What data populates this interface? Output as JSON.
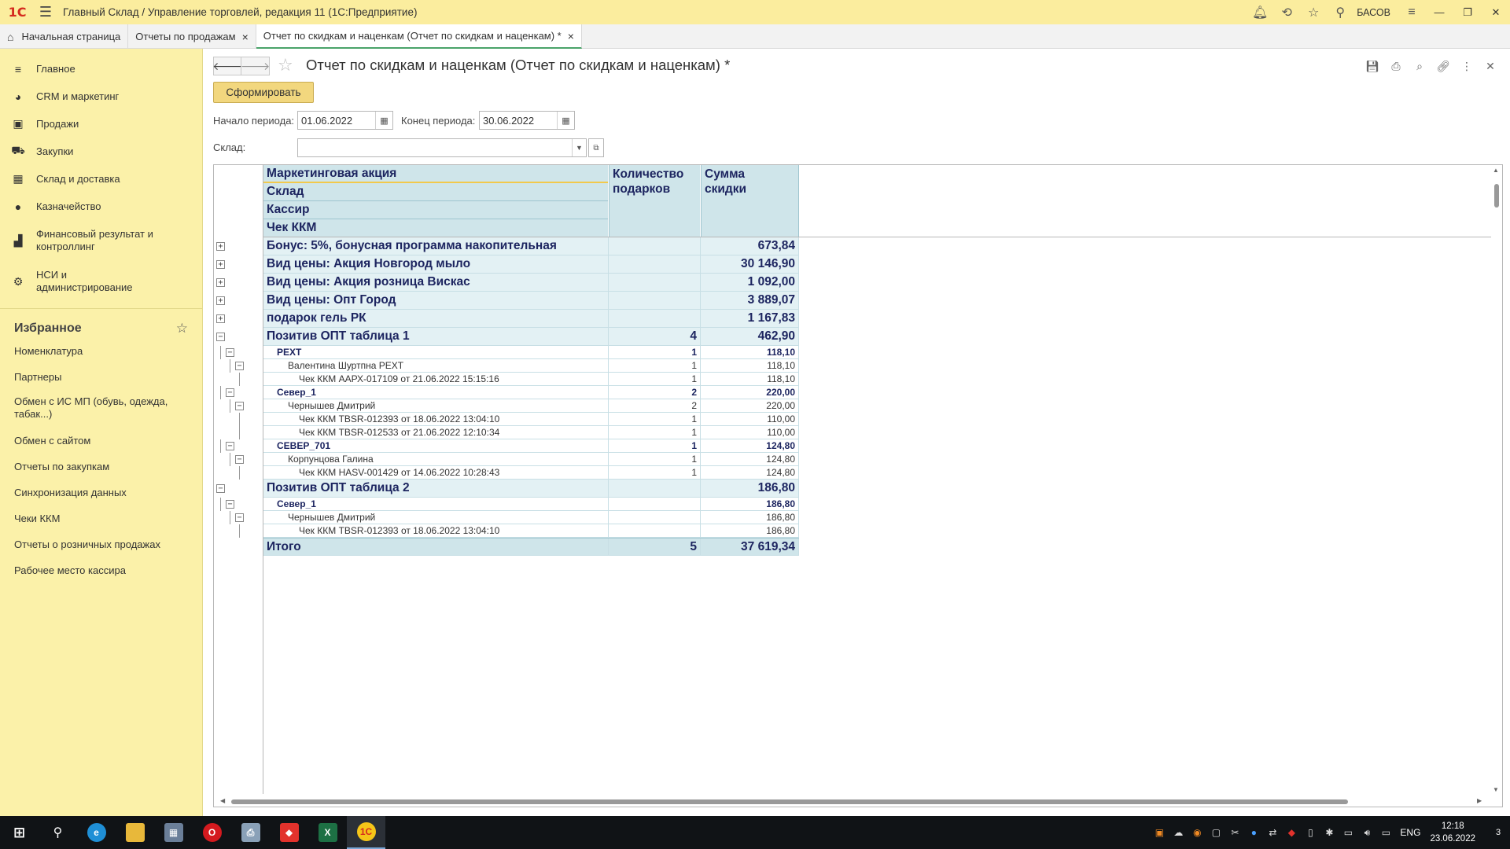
{
  "titlebar": {
    "logo": "1С",
    "title": "Главный Склад / Управление торговлей, редакция 11  (1С:Предприятие)",
    "user": "БАСОВ"
  },
  "tabs": [
    {
      "label": "Начальная страница"
    },
    {
      "label": "Отчеты по продажам"
    },
    {
      "label": "Отчет по скидкам и наценкам (Отчет по скидкам и наценкам) *"
    }
  ],
  "sidebar": {
    "items": [
      {
        "label": "Главное",
        "icon": "list-icon"
      },
      {
        "label": "CRM и маркетинг",
        "icon": "pie-icon"
      },
      {
        "label": "Продажи",
        "icon": "bag-icon"
      },
      {
        "label": "Закупки",
        "icon": "cart-icon"
      },
      {
        "label": "Склад и доставка",
        "icon": "grid-icon"
      },
      {
        "label": "Казначейство",
        "icon": "coin-icon"
      },
      {
        "label": "Финансовый результат и контроллинг",
        "icon": "bar-chart-icon"
      },
      {
        "label": "НСИ и администрирование",
        "icon": "gear-icon"
      }
    ],
    "favorites_title": "Избранное",
    "favorites": [
      "Номенклатура",
      "Партнеры",
      "Обмен с ИС МП (обувь, одежда, табак...)",
      "Обмен с сайтом",
      "Отчеты по закупкам",
      "Синхронизация данных",
      "Чеки ККМ",
      "Отчеты о розничных продажах",
      "Рабочее место кассира"
    ]
  },
  "form": {
    "title": "Отчет по скидкам и наценкам (Отчет по скидкам и наценкам) *",
    "generate_label": "Сформировать",
    "period_start_label": "Начало периода:",
    "period_start_value": "01.06.2022",
    "period_end_label": "Конец периода:",
    "period_end_value": "30.06.2022",
    "sklad_label": "Склад:",
    "sklad_value": ""
  },
  "report": {
    "headers": {
      "groupings": [
        "Маркетинговая акция",
        "Склад",
        "Кассир",
        "Чек ККМ"
      ],
      "qty_line1": "Количество",
      "qty_line2": "подарков",
      "sum_line1": "Сумма",
      "sum_line2": "скидки"
    },
    "rows": [
      {
        "level": 1,
        "label": "Бонус: 5%, бонусная программа накопительная",
        "qty": "",
        "sum": "673,84",
        "toggle": "+"
      },
      {
        "level": 1,
        "label": "Вид цены: Акция Новгород мыло",
        "qty": "",
        "sum": "30 146,90",
        "toggle": "+"
      },
      {
        "level": 1,
        "label": "Вид цены: Акция розница Вискас",
        "qty": "",
        "sum": "1 092,00",
        "toggle": "+"
      },
      {
        "level": 1,
        "label": "Вид цены: Опт Город",
        "qty": "",
        "sum": "3 889,07",
        "toggle": "+"
      },
      {
        "level": 1,
        "label": "подарок гель РК",
        "qty": "",
        "sum": "1 167,83",
        "toggle": "+"
      },
      {
        "level": 1,
        "label": "Позитив ОПТ таблица 1",
        "qty": "4",
        "sum": "462,90",
        "toggle": "−"
      },
      {
        "level": 2,
        "label": "РЕХТ",
        "qty": "1",
        "sum": "118,10",
        "toggle": "−"
      },
      {
        "level": 3,
        "label": "Валентина Шуртпна РЕХТ",
        "qty": "1",
        "sum": "118,10",
        "toggle": "−"
      },
      {
        "level": 4,
        "label": "Чек ККМ ААРХ-017109 от 21.06.2022 15:15:16",
        "qty": "1",
        "sum": "118,10",
        "toggle": ""
      },
      {
        "level": 2,
        "label": "Север_1",
        "qty": "2",
        "sum": "220,00",
        "toggle": "−"
      },
      {
        "level": 3,
        "label": "Чернышев Дмитрий",
        "qty": "2",
        "sum": "220,00",
        "toggle": "−"
      },
      {
        "level": 4,
        "label": "Чек ККМ TBSR-012393 от 18.06.2022 13:04:10",
        "qty": "1",
        "sum": "110,00",
        "toggle": ""
      },
      {
        "level": 4,
        "label": "Чек ККМ TBSR-012533 от 21.06.2022 12:10:34",
        "qty": "1",
        "sum": "110,00",
        "toggle": ""
      },
      {
        "level": 2,
        "label": "СЕВЕР_701",
        "qty": "1",
        "sum": "124,80",
        "toggle": "−"
      },
      {
        "level": 3,
        "label": "Корпунцова Галина",
        "qty": "1",
        "sum": "124,80",
        "toggle": "−"
      },
      {
        "level": 4,
        "label": "Чек ККМ HASV-001429 от 14.06.2022 10:28:43",
        "qty": "1",
        "sum": "124,80",
        "toggle": ""
      },
      {
        "level": 1,
        "label": "Позитив ОПТ таблица 2",
        "qty": "",
        "sum": "186,80",
        "toggle": "−"
      },
      {
        "level": 2,
        "label": "Север_1",
        "qty": "",
        "sum": "186,80",
        "toggle": "−"
      },
      {
        "level": 3,
        "label": "Чернышев Дмитрий",
        "qty": "",
        "sum": "186,80",
        "toggle": "−"
      },
      {
        "level": 4,
        "label": "Чек ККМ TBSR-012393 от 18.06.2022 13:04:10",
        "qty": "",
        "sum": "186,80",
        "toggle": ""
      }
    ],
    "total": {
      "label": "Итого",
      "qty": "5",
      "sum": "37 619,34"
    }
  },
  "taskbar": {
    "lang": "ENG",
    "time": "12:18",
    "date": "23.06.2022",
    "notifications": "3"
  },
  "colors": {
    "titlebar": "#fbed9e",
    "sidebar": "#fbf1a9",
    "report_header": "#cfe5ea",
    "report_text": "#1d2560",
    "button": "#f2d77e"
  }
}
